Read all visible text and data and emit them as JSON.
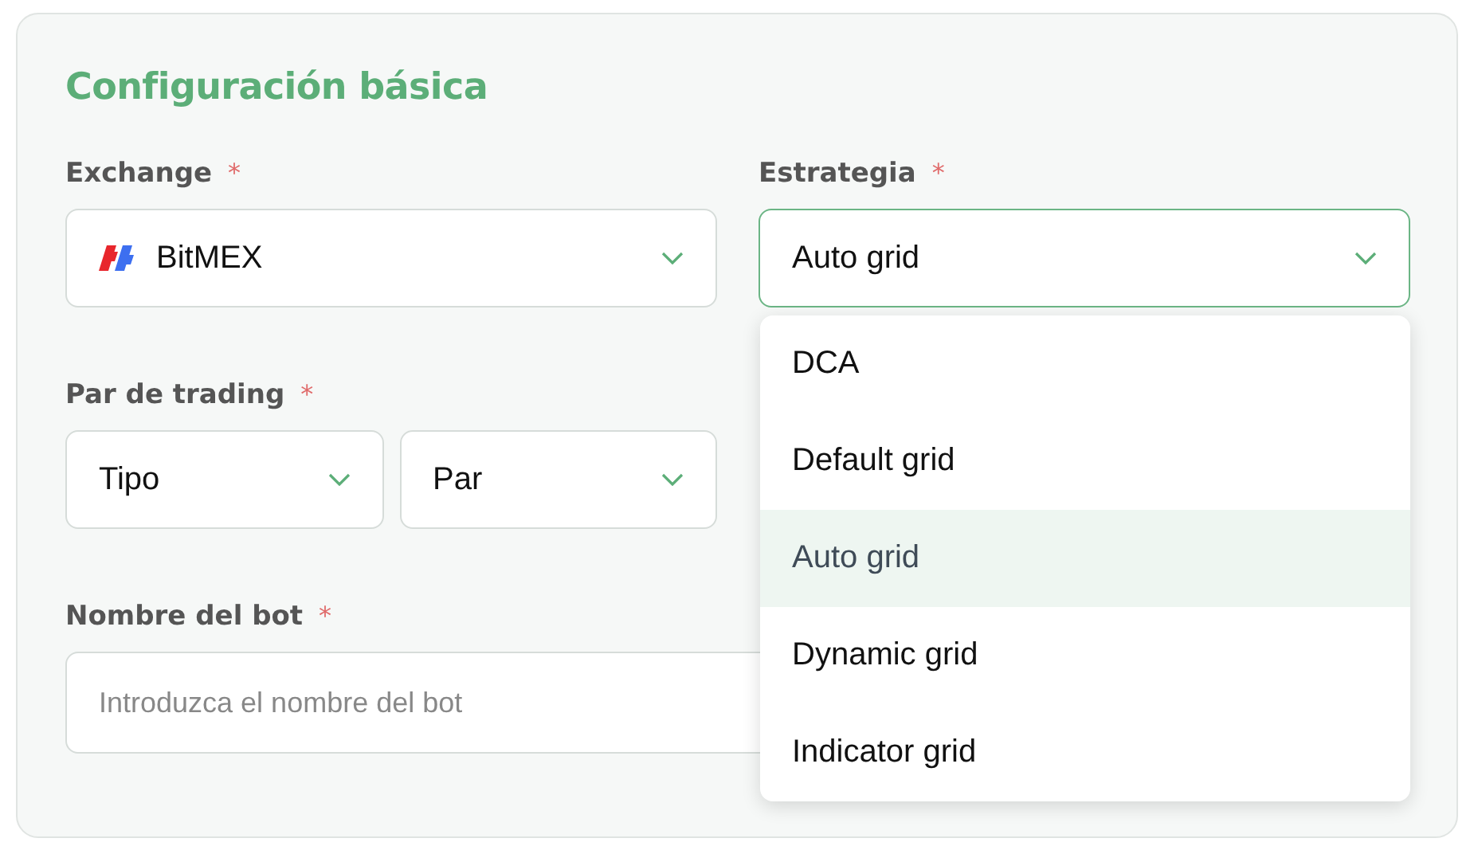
{
  "section": {
    "title": "Configuración básica"
  },
  "exchange": {
    "label": "Exchange",
    "required_mark": "*",
    "value": "BitMEX",
    "open": false
  },
  "strategy": {
    "label": "Estrategia",
    "required_mark": "*",
    "value": "Auto grid",
    "open": true,
    "options": [
      {
        "label": "DCA",
        "selected": false
      },
      {
        "label": "Default grid",
        "selected": false
      },
      {
        "label": "Auto grid",
        "selected": true
      },
      {
        "label": "Dynamic grid",
        "selected": false
      },
      {
        "label": "Indicator grid",
        "selected": false
      }
    ]
  },
  "trading_pair": {
    "label": "Par de trading",
    "required_mark": "*",
    "selects": [
      {
        "value": "Tipo",
        "open": false
      },
      {
        "value": "Par",
        "open": false
      }
    ]
  },
  "bot_name": {
    "label": "Nombre del bot",
    "required_mark": "*",
    "placeholder": "Introduzca el nombre del bot"
  }
}
